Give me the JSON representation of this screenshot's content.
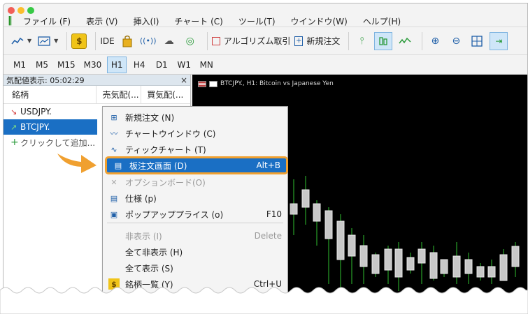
{
  "menubar": {
    "items": [
      "ファイル (F)",
      "表示 (V)",
      "挿入(I)",
      "チャート (C)",
      "ツール(T)",
      "ウインドウ(W)",
      "ヘルプ(H)"
    ]
  },
  "toolbar": {
    "ide_label": "IDE",
    "algo_label": "アルゴリズム取引",
    "new_order_label": "新規注文"
  },
  "timeframes": [
    "M1",
    "M5",
    "M15",
    "M30",
    "H1",
    "H4",
    "D1",
    "W1",
    "MN"
  ],
  "timeframe_active": "H1",
  "market_watch": {
    "header": "気配値表示: 05:02:29",
    "columns": [
      "銘柄",
      "売気配(...",
      "買気配(..."
    ],
    "rows": [
      {
        "symbol": "USDJPY."
      },
      {
        "symbol": "BTCJPY."
      }
    ],
    "add_label": "クリックして追加..."
  },
  "chart": {
    "title": "BTCJPY., H1:  Bitcoin vs Japanese Yen"
  },
  "context_menu": {
    "items": [
      {
        "label": "新規注文 (N)",
        "shortcut": "",
        "icon": "new-order-icon",
        "state": "normal"
      },
      {
        "label": "チャートウインドウ (C)",
        "shortcut": "",
        "icon": "chart-window-icon",
        "state": "normal"
      },
      {
        "label": "ティックチャート (T)",
        "shortcut": "",
        "icon": "tick-chart-icon",
        "state": "normal"
      },
      {
        "label": "板注文画面 (D)",
        "shortcut": "Alt+B",
        "icon": "depth-of-market-icon",
        "state": "highlight"
      },
      {
        "label": "オプションボード(O)",
        "shortcut": "",
        "icon": "option-board-icon",
        "state": "disabled"
      },
      {
        "label": "仕様 (p)",
        "shortcut": "",
        "icon": "specification-icon",
        "state": "normal"
      },
      {
        "label": "ポップアッププライス (o)",
        "shortcut": "F10",
        "icon": "popup-prices-icon",
        "state": "normal"
      },
      {
        "label": "非表示 (I)",
        "shortcut": "Delete",
        "icon": "",
        "state": "disabled"
      },
      {
        "label": "全て非表示 (H)",
        "shortcut": "",
        "icon": "",
        "state": "normal"
      },
      {
        "label": "全て表示 (S)",
        "shortcut": "",
        "icon": "",
        "state": "normal"
      },
      {
        "label": "銘柄一覧 (Y)",
        "shortcut": "Ctrl+U",
        "icon": "symbols-icon",
        "state": "normal"
      }
    ]
  },
  "colors": {
    "accent": "#1a6fc4",
    "callout": "#f0a030",
    "candle_body": "#c8c8c8",
    "wick": "#2fbf2f"
  }
}
